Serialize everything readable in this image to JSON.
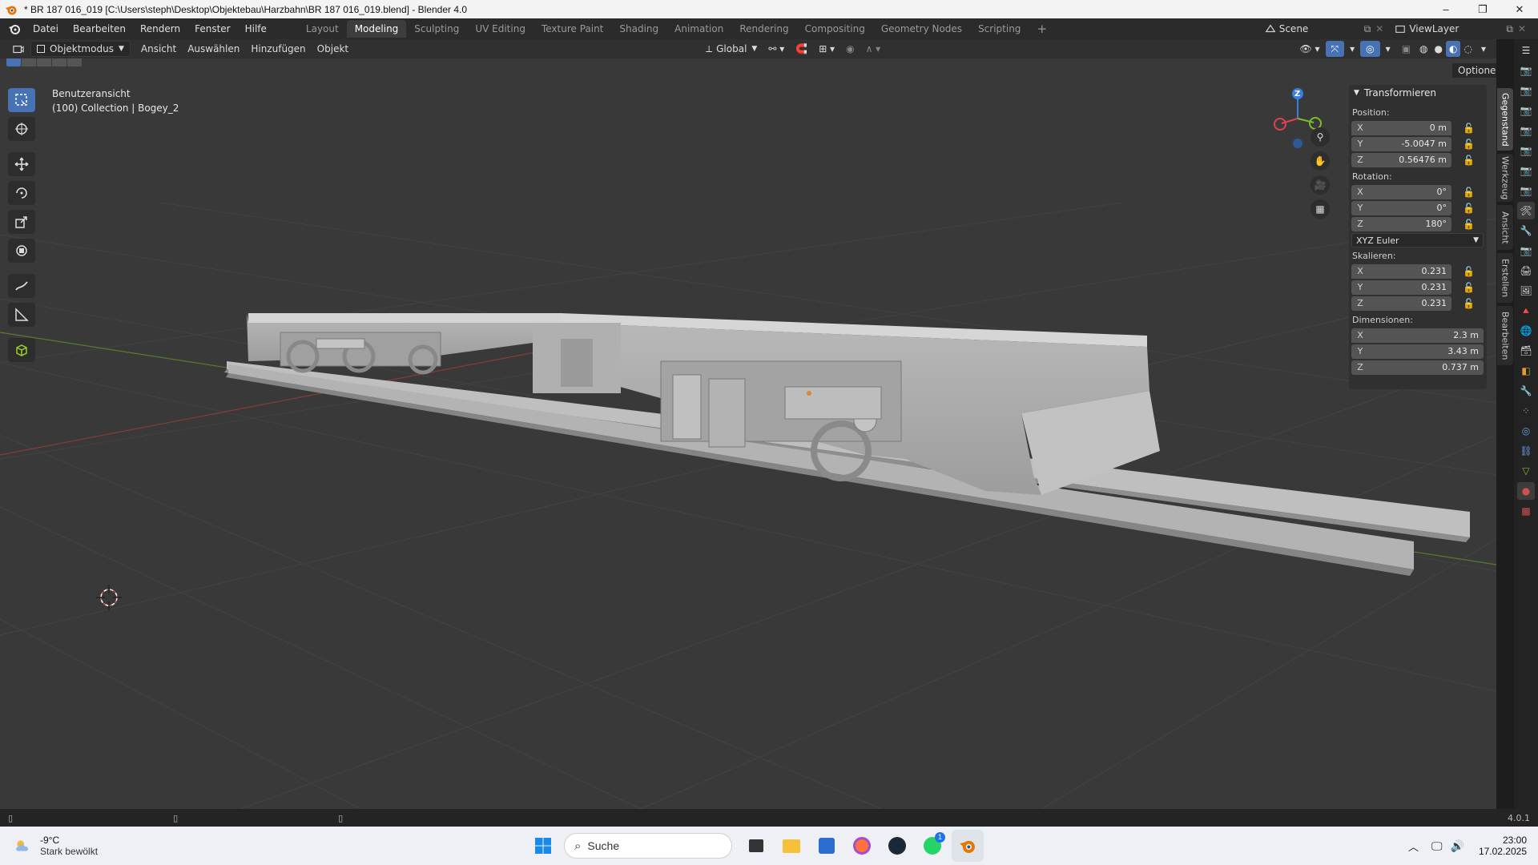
{
  "window": {
    "title": "* BR 187 016_019 [C:\\Users\\steph\\Desktop\\Objektebau\\Harzbahn\\BR 187 016_019.blend] - Blender 4.0",
    "minimize": "–",
    "maximize": "❐",
    "close": "✕"
  },
  "menus": [
    "Datei",
    "Bearbeiten",
    "Rendern",
    "Fenster",
    "Hilfe"
  ],
  "workspaces": [
    "Layout",
    "Modeling",
    "Sculpting",
    "UV Editing",
    "Texture Paint",
    "Shading",
    "Animation",
    "Rendering",
    "Compositing",
    "Geometry Nodes",
    "Scripting",
    "+"
  ],
  "active_workspace": "Modeling",
  "scene": {
    "name": "Scene",
    "viewlayer": "ViewLayer"
  },
  "header": {
    "mode": "Objektmodus",
    "menus": [
      "Ansicht",
      "Auswählen",
      "Hinzufügen",
      "Objekt"
    ],
    "orientation": "Global",
    "options": "Optionen"
  },
  "viewport": {
    "view_name": "Benutzeransicht",
    "collection_info": "(100) Collection | Bogey_2",
    "gizmo_z": "Z"
  },
  "npanel": {
    "section": "Transformieren",
    "position_label": "Position:",
    "position": [
      {
        "axis": "X",
        "value": "0 m"
      },
      {
        "axis": "Y",
        "value": "-5.0047 m"
      },
      {
        "axis": "Z",
        "value": "0.56476 m"
      }
    ],
    "rotation_label": "Rotation:",
    "rotation": [
      {
        "axis": "X",
        "value": "0°"
      },
      {
        "axis": "Y",
        "value": "0°"
      },
      {
        "axis": "Z",
        "value": "180°"
      }
    ],
    "rotation_mode": "XYZ Euler",
    "scale_label": "Skalieren:",
    "scale": [
      {
        "axis": "X",
        "value": "0.231"
      },
      {
        "axis": "Y",
        "value": "0.231"
      },
      {
        "axis": "Z",
        "value": "0.231"
      }
    ],
    "dimensions_label": "Dimensionen:",
    "dimensions": [
      {
        "axis": "X",
        "value": "2.3 m"
      },
      {
        "axis": "Y",
        "value": "3.43 m"
      },
      {
        "axis": "Z",
        "value": "0.737 m"
      }
    ]
  },
  "side_tabs": [
    "Gegenstand",
    "Werkzeug",
    "Ansicht",
    "Erstellen",
    "Bearbeiten"
  ],
  "status": {
    "version": "4.0.1"
  },
  "taskbar": {
    "weather_temp": "-9°C",
    "weather_desc": "Stark bewölkt",
    "search_placeholder": "Suche",
    "whatsapp_badge": "1",
    "time": "23:00",
    "date": "17.02.2025"
  },
  "colors": {
    "accent": "#4772b3",
    "axis_x": "#e0424f",
    "axis_y": "#7cbd2a",
    "axis_z": "#3a7ee0",
    "model": "#c8c8c8"
  }
}
